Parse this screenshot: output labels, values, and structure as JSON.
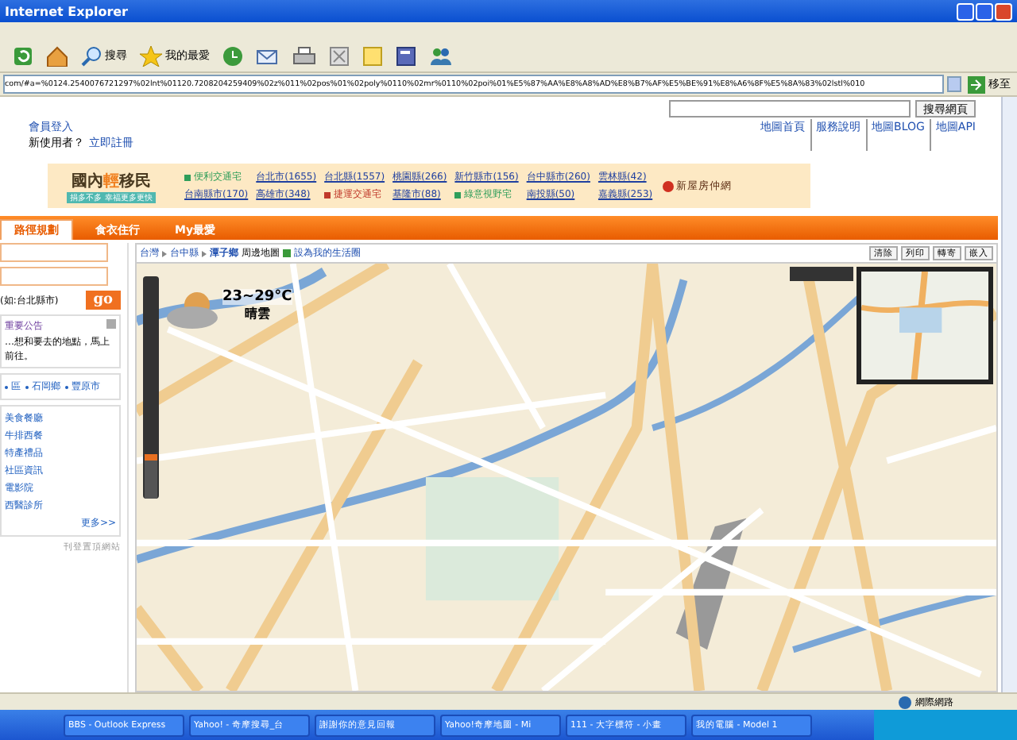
{
  "window": {
    "title": "Internet Explorer"
  },
  "toolbar": {
    "buttons": [
      {
        "kind": "refresh"
      },
      {
        "kind": "home"
      },
      {
        "kind": "search",
        "label": "搜尋"
      },
      {
        "kind": "favorites",
        "label": "我的最愛"
      },
      {
        "kind": "history"
      },
      {
        "kind": "mail"
      },
      {
        "kind": "print"
      },
      {
        "kind": "edit"
      },
      {
        "kind": "note"
      },
      {
        "kind": "research"
      },
      {
        "kind": "messenger"
      }
    ]
  },
  "address": {
    "value": "com/#a=%0124.2540076721297%02lnt%01120.7208204259409%02z%011%02pos%01%02poly%0110%02mr%0110%02poi%01%E5%87%AA%E8%A8%AD%E8%B7%AF%E5%BE%91%E8%A6%8F%E5%8A%83%02lstl%010",
    "go": "移至"
  },
  "page": {
    "search_button": "搜尋網頁",
    "login": "會員登入",
    "new_user": "新使用者？",
    "register": "立即註冊",
    "top_links": [
      "地圖首頁",
      "服務說明",
      "地圖BLOG",
      "地圖API"
    ],
    "ad": {
      "title_a": "國內",
      "title_b": "輕",
      "title_c": "移民",
      "slogan": "捐多不多 幸福更多更快",
      "rows": [
        [
          {
            "kind": "tag",
            "text": "便利交通宅",
            "color": "#2f9e5a"
          },
          {
            "kind": "link",
            "text": "台北市(1655)"
          },
          {
            "kind": "link",
            "text": "台北縣(1557)"
          },
          {
            "kind": "link",
            "text": "桃園縣(266)"
          },
          {
            "kind": "link",
            "text": "新竹縣市(156)"
          },
          {
            "kind": "link",
            "text": "台中縣市(260)"
          },
          {
            "kind": "link",
            "text": "雲林縣(42)"
          }
        ],
        [
          {
            "kind": "link",
            "text": "台南縣市(170)"
          },
          {
            "kind": "link",
            "text": "高雄市(348)"
          },
          {
            "kind": "tag",
            "text": "捷運交通宅",
            "color": "#c0392b"
          },
          {
            "kind": "link",
            "text": "基隆市(88)"
          },
          {
            "kind": "tag",
            "text": "綠意視野宅",
            "color": "#2f9e5a"
          },
          {
            "kind": "link",
            "text": "南投縣(50)"
          },
          {
            "kind": "link",
            "text": "嘉義縣(253)"
          }
        ]
      ],
      "badge": "新屋房仲網"
    },
    "tabs": [
      {
        "label": "路徑規劃",
        "selected": true
      },
      {
        "label": "食衣住行",
        "selected": false
      },
      {
        "label": "My最愛",
        "selected": false
      }
    ],
    "left": {
      "hint": "(如:台北縣市)",
      "go": "go",
      "notice_title": "重要公告",
      "notice_text": "…想和要去的地點，馬上前往。",
      "areas": [
        "區",
        "石岡鄉",
        "豐原市"
      ],
      "links": [
        "美食餐廳",
        "牛排西餐",
        "特產禮品",
        "社區資訊",
        "電影院",
        "西醫診所"
      ],
      "more": "更多>>",
      "footer": "刊登置頂網站"
    },
    "map": {
      "breadcrumb": [
        "台灣",
        "台中縣",
        "潭子鄉"
      ],
      "suffix": "周邊地圖",
      "set_area": "設為我的生活圈",
      "actions": [
        "清除",
        "列印",
        "轉寄",
        "嵌入"
      ],
      "zoom": {
        "level": 0.2
      },
      "weather": {
        "temp": "23~29°C",
        "desc": "晴雲"
      }
    }
  },
  "status_bar": {
    "zone": "網際網路"
  },
  "taskbar": [
    "BBS - Outlook Express",
    "Yahoo! - 奇摩搜尋_台",
    "謝謝你的意見回報",
    "Yahoo!奇摩地圖 - Mi",
    "111 - 大字標符 - 小畫",
    "我的電腦 - Model 1"
  ]
}
